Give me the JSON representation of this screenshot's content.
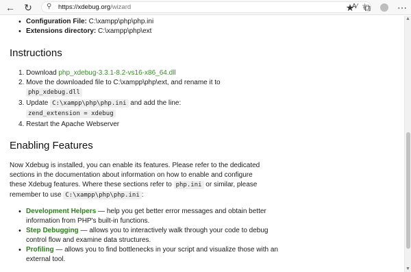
{
  "browser": {
    "url_host": "https://xdebug.org",
    "url_path": "/wizard"
  },
  "top_list": [
    {
      "label": "Configuration File:",
      "value": "C:\\xampp\\php\\php.ini"
    },
    {
      "label": "Extensions directory:",
      "value": "C:\\xampp\\php\\ext"
    }
  ],
  "instructions": {
    "heading": "Instructions",
    "step1_prefix": "1. Download ",
    "step1_link": "php_xdebug-3.3.1-8.2-vs16-x86_64.dll",
    "step2_text": "2. Move the downloaded file to C:\\xampp\\php\\ext, and rename it to",
    "step2_code": "php_xdebug.dll",
    "step3_prefix": "3. Update ",
    "step3_code": "C:\\xampp\\php\\php.ini",
    "step3_suffix": " and add the line:",
    "step3_line": "zend_extension = xdebug",
    "step4_text": "4. Restart the Apache Webserver"
  },
  "features": {
    "heading": "Enabling Features",
    "p1": "Now Xdebug is installed, you can enable its features. Please refer to the dedicated",
    "p2": "sections in the documentation about information on how to enable and configure",
    "p3_prefix": "these Xdebug features. Where these sections refer to ",
    "p3_code": "php.ini",
    "p3_suffix": " or similar, please",
    "p4_prefix": "remember to use ",
    "p4_code": "C:\\xampp\\php\\php.ini",
    "p4_suffix": ":",
    "items": [
      {
        "name": "Development Helpers",
        "line1": " — help you get better error messages and obtain better",
        "line2": "information from PHP's built-in functions."
      },
      {
        "name": "Step Debugging",
        "line1": " — allows you to interactively walk through your code to debug",
        "line2": "control flow and examine data structures."
      },
      {
        "name": "Profiling",
        "line1": " — allows you to find bottlenecks in your script and visualize those with an",
        "line2": "external tool."
      }
    ]
  }
}
